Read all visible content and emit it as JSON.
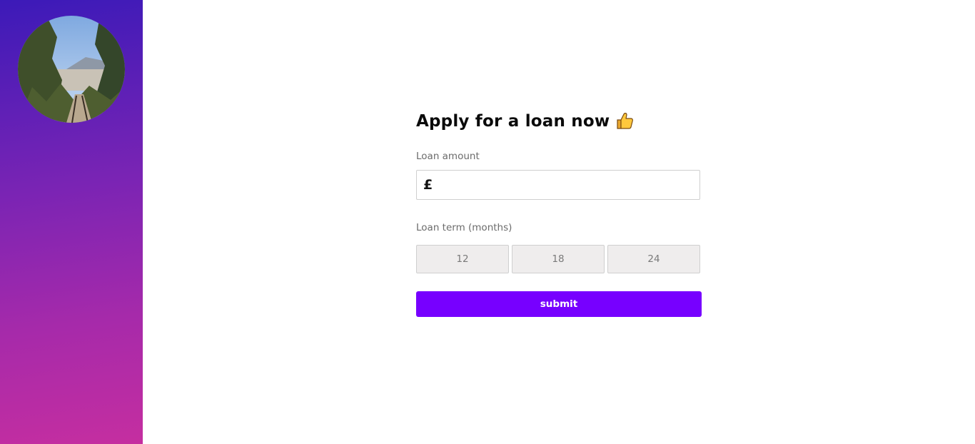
{
  "sidebar": {
    "avatar_icon": "profile-photo-icon",
    "gradient_colors": [
      "#3c1ab8",
      "#c52ea0"
    ]
  },
  "form": {
    "title": "Apply for a loan now",
    "title_icon": "thumbs-up-icon",
    "amount_label": "Loan amount",
    "currency_symbol": "£",
    "amount_value": "",
    "term_label": "Loan term (months)",
    "terms": [
      "12",
      "18",
      "24"
    ],
    "submit_label": "submit"
  },
  "colors": {
    "accent": "#7700ff",
    "option_bg": "#efeded",
    "border": "#cfcfcf",
    "label_text": "#6b6b6b"
  }
}
